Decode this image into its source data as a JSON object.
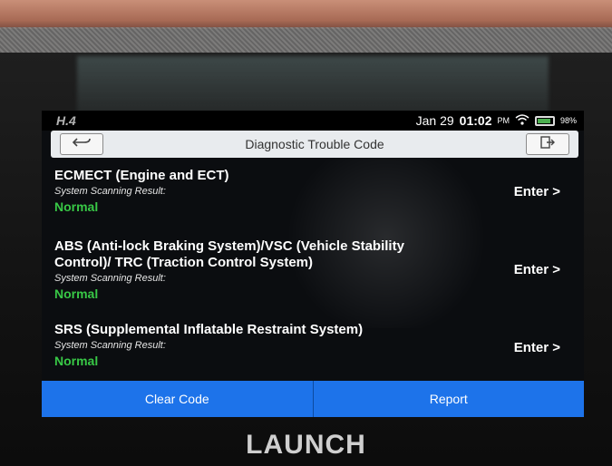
{
  "status_bar": {
    "left_text": "H.4",
    "date": "Jan 29",
    "time": "01:02",
    "ampm": "PM",
    "battery": "98%"
  },
  "header": {
    "title": "Diagnostic Trouble Code",
    "back_icon": "back-arrow-icon",
    "exit_icon": "exit-icon"
  },
  "systems": [
    {
      "name": "ECMECT (Engine and ECT)",
      "scan_label": "System Scanning Result:",
      "result": "Normal",
      "enter": "Enter >"
    },
    {
      "name": "ABS (Anti-lock Braking System)/VSC (Vehicle Stability Control)/ TRC (Traction Control System)",
      "scan_label": "System Scanning Result:",
      "result": "Normal",
      "enter": "Enter >"
    },
    {
      "name": "SRS (Supplemental Inflatable Restraint System)",
      "scan_label": "System Scanning Result:",
      "result": "Normal",
      "enter": "Enter >"
    }
  ],
  "footer": {
    "clear_code": "Clear Code",
    "report": "Report"
  },
  "device": {
    "brand": "LAUNCH"
  },
  "colors": {
    "accent": "#1d73ea",
    "normal_status": "#38c846"
  }
}
